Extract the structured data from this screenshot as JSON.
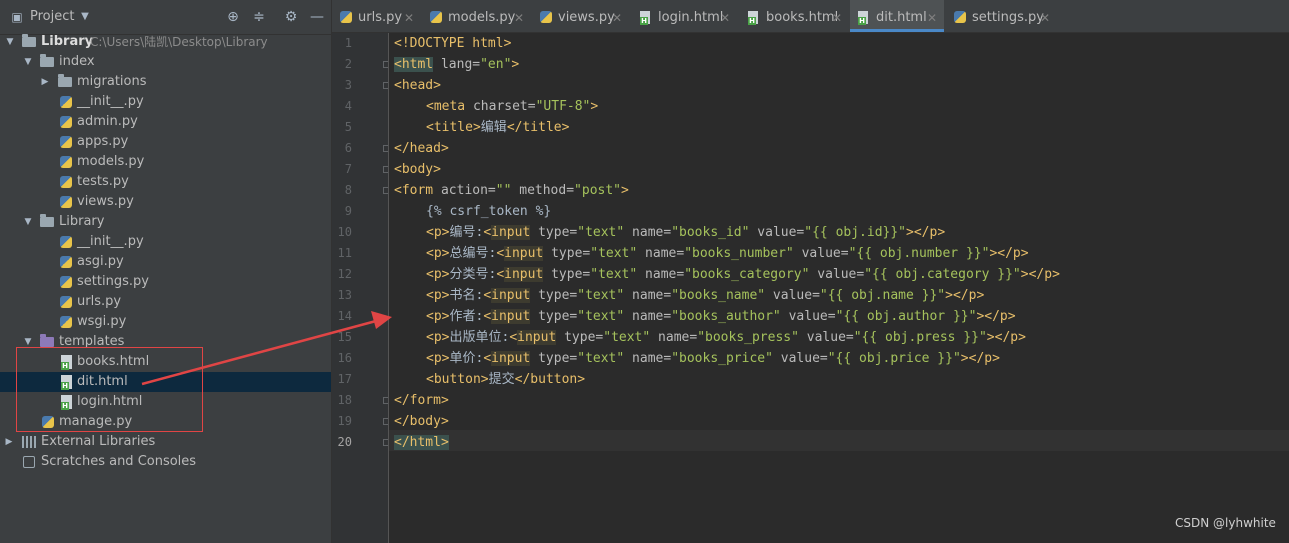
{
  "project_panel": {
    "title": "Project",
    "tree": [
      {
        "label": "Library",
        "path": "C:\\Users\\陆凯\\Desktop\\Library",
        "type": "folder",
        "icon": "folder-icon",
        "expanded": true,
        "bold": true
      },
      {
        "label": "index",
        "type": "folder",
        "icon": "folder-icon",
        "expanded": true
      },
      {
        "label": "migrations",
        "type": "folder",
        "icon": "folder-icon",
        "expanded": false
      },
      {
        "label": "__init__.py",
        "type": "py",
        "icon": "python-file-icon"
      },
      {
        "label": "admin.py",
        "type": "py",
        "icon": "python-file-icon"
      },
      {
        "label": "apps.py",
        "type": "py",
        "icon": "python-file-icon"
      },
      {
        "label": "models.py",
        "type": "py",
        "icon": "python-file-icon"
      },
      {
        "label": "tests.py",
        "type": "py",
        "icon": "python-file-icon"
      },
      {
        "label": "views.py",
        "type": "py",
        "icon": "python-file-icon"
      },
      {
        "label": "Library",
        "type": "folder",
        "icon": "folder-icon",
        "expanded": true
      },
      {
        "label": "__init__.py",
        "type": "py",
        "icon": "python-file-icon"
      },
      {
        "label": "asgi.py",
        "type": "py",
        "icon": "python-file-icon"
      },
      {
        "label": "settings.py",
        "type": "py",
        "icon": "python-file-icon"
      },
      {
        "label": "urls.py",
        "type": "py",
        "icon": "python-file-icon"
      },
      {
        "label": "wsgi.py",
        "type": "py",
        "icon": "python-file-icon"
      },
      {
        "label": "templates",
        "type": "folder",
        "icon": "template-folder-icon",
        "expanded": true
      },
      {
        "label": "books.html",
        "type": "html",
        "icon": "html-file-icon"
      },
      {
        "label": "dit.html",
        "type": "html",
        "icon": "html-file-icon",
        "selected": true
      },
      {
        "label": "login.html",
        "type": "html",
        "icon": "html-file-icon"
      },
      {
        "label": "manage.py",
        "type": "py",
        "icon": "python-file-icon"
      },
      {
        "label": "External Libraries",
        "type": "lib",
        "icon": "library-icon",
        "expanded": false
      },
      {
        "label": "Scratches and Consoles",
        "type": "scratch",
        "icon": "scratch-icon"
      }
    ]
  },
  "tabs": [
    {
      "label": "urls.py",
      "icon": "python-file-icon"
    },
    {
      "label": "models.py",
      "icon": "python-file-icon"
    },
    {
      "label": "views.py",
      "icon": "python-file-icon"
    },
    {
      "label": "login.html",
      "icon": "html-file-icon"
    },
    {
      "label": "books.html",
      "icon": "html-file-icon"
    },
    {
      "label": "dit.html",
      "icon": "html-file-icon",
      "active": true
    },
    {
      "label": "settings.py",
      "icon": "python-file-icon"
    }
  ],
  "editor": {
    "line_numbers": [
      "1",
      "2",
      "3",
      "4",
      "5",
      "6",
      "7",
      "8",
      "9",
      "10",
      "11",
      "12",
      "13",
      "14",
      "15",
      "16",
      "17",
      "18",
      "19",
      "20"
    ],
    "current_line": "20",
    "code": {
      "l1": "<!DOCTYPE html>",
      "l2_tag": "<html",
      "l2_attr": " lang=",
      "l2_val": "\"en\"",
      "l2_end": ">",
      "l3": "<head>",
      "l4_tag": "<meta",
      "l4_attr": " charset=",
      "l4_val": "\"UTF-8\"",
      "l4_end": ">",
      "l5_open": "<title>",
      "l5_text": "编辑",
      "l5_close": "</title>",
      "l6": "</head>",
      "l7": "<body>",
      "l8_tag": "<form",
      "l8_attr1": " action=",
      "l8_val1": "\"\"",
      "l8_attr2": " method=",
      "l8_val2": "\"post\"",
      "l8_end": ">",
      "l9": "{% csrf_token %}",
      "p_open": "<p>",
      "p_close": "</p>",
      "inp_lt": "<",
      "inp_word": "input",
      "attr_type": " type=",
      "val_text": "\"text\"",
      "attr_name": " name=",
      "attr_value": " value=",
      "tag_end": ">",
      "l10_label": "编号:",
      "l10_name": "\"books_id\"",
      "l10_value": "\"{{ obj.id}}\"",
      "l11_label": "总编号:",
      "l11_name": "\"books_number\"",
      "l11_value": "\"{{ obj.number }}\"",
      "l12_label": "分类号:",
      "l12_name": "\"books_category\"",
      "l12_value": "\"{{ obj.category }}\"",
      "l13_label": "书名:",
      "l13_name": "\"books_name\"",
      "l13_value": "\"{{ obj.name }}\"",
      "l14_label": "作者:",
      "l14_name": "\"books_author\"",
      "l14_value": "\"{{ obj.author }}\"",
      "l15_label": "出版单位:",
      "l15_name": "\"books_press\"",
      "l15_value": "\"{{ obj.press }}\"",
      "l16_label": "单价:",
      "l16_name": "\"books_price\"",
      "l16_value": "\"{{ obj.price }}\"",
      "l17_open": "<button>",
      "l17_text": "提交",
      "l17_close": "</button>",
      "l18": "</form>",
      "l19": "</body>",
      "l20": "</html>"
    }
  },
  "watermark": "CSDN @lyhwhite",
  "colors": {
    "editor_bg": "#2b2b2b",
    "panel_bg": "#3c3f41",
    "tag": "#e8bf6a",
    "attr_value": "#a5c25c",
    "selection": "#0d293e",
    "annotation": "#e04545"
  }
}
